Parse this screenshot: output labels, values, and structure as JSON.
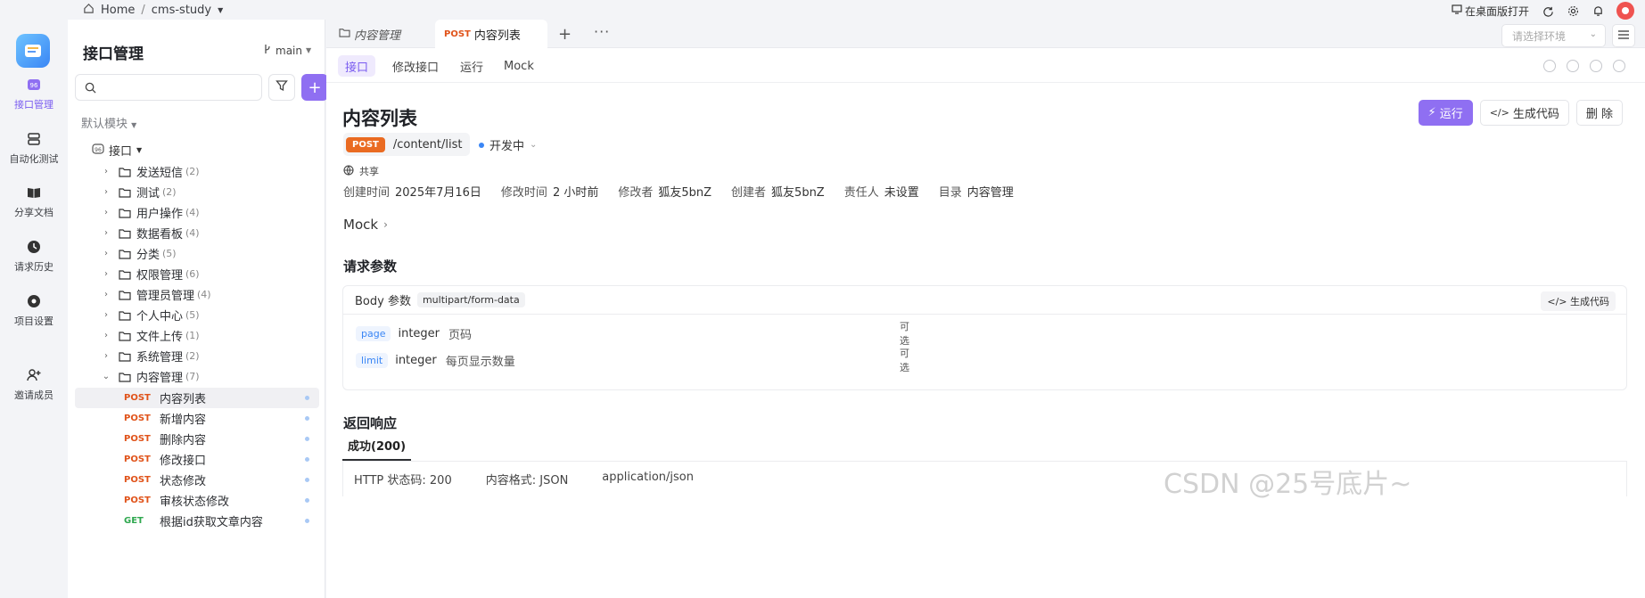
{
  "breadcrumb": {
    "home": "Home",
    "sep": "/",
    "project": "cms-study"
  },
  "topbar": {
    "open_desktop": "在桌面版打开"
  },
  "rail": [
    {
      "label": "接口管理",
      "icon": "api-icon"
    },
    {
      "label": "自动化测试",
      "icon": "automation-icon"
    },
    {
      "label": "分享文档",
      "icon": "book-icon"
    },
    {
      "label": "请求历史",
      "icon": "clock-icon"
    },
    {
      "label": "项目设置",
      "icon": "gear-icon"
    },
    {
      "label": "邀请成员",
      "icon": "user-plus-icon"
    }
  ],
  "sidebar": {
    "title": "接口管理",
    "branch": "main",
    "module": "默认模块",
    "root": "接口",
    "folders": [
      {
        "name": "发送短信",
        "count": "(2)"
      },
      {
        "name": "测试",
        "count": "(2)"
      },
      {
        "name": "用户操作",
        "count": "(4)"
      },
      {
        "name": "数据看板",
        "count": "(4)"
      },
      {
        "name": "分类",
        "count": "(5)"
      },
      {
        "name": "权限管理",
        "count": "(6)"
      },
      {
        "name": "管理员管理",
        "count": "(4)"
      },
      {
        "name": "个人中心",
        "count": "(5)"
      },
      {
        "name": "文件上传",
        "count": "(1)"
      },
      {
        "name": "系统管理",
        "count": "(2)"
      },
      {
        "name": "内容管理",
        "count": "(7)"
      }
    ],
    "apis": [
      {
        "method": "POST",
        "name": "内容列表"
      },
      {
        "method": "POST",
        "name": "新增内容"
      },
      {
        "method": "POST",
        "name": "删除内容"
      },
      {
        "method": "POST",
        "name": "修改接口"
      },
      {
        "method": "POST",
        "name": "状态修改"
      },
      {
        "method": "POST",
        "name": "审核状态修改"
      },
      {
        "method": "GET",
        "name": "根据id获取文章内容"
      }
    ]
  },
  "tabs": {
    "folder_tab": "内容管理",
    "active_method": "POST",
    "active_tab": "内容列表",
    "env_placeholder": "请选择环境"
  },
  "subtabs": [
    "接口",
    "修改接口",
    "运行",
    "Mock"
  ],
  "api": {
    "title": "内容列表",
    "method": "POST",
    "path": "/content/list",
    "status": "开发中",
    "share": "共享",
    "run_label": "运行",
    "gen_code_label": "生成代码",
    "delete_label": "删 除",
    "meta": [
      {
        "k": "创建时间",
        "v": "2025年7月16日"
      },
      {
        "k": "修改时间",
        "v": "2 小时前"
      },
      {
        "k": "修改者",
        "v": "狐友5bnZ"
      },
      {
        "k": "创建者",
        "v": "狐友5bnZ"
      },
      {
        "k": "责任人",
        "v": "未设置"
      },
      {
        "k": "目录",
        "v": "内容管理"
      }
    ],
    "mock": "Mock"
  },
  "request": {
    "title": "请求参数",
    "body_label": "Body 参数",
    "content_type": "multipart/form-data",
    "gen_code": "生成代码",
    "params": [
      {
        "name": "page",
        "type": "integer",
        "desc": "页码",
        "opt": "可选"
      },
      {
        "name": "limit",
        "type": "integer",
        "desc": "每页显示数量",
        "opt": "可选"
      }
    ]
  },
  "response": {
    "title": "返回响应",
    "tab": "成功(200)",
    "status_code": "HTTP 状态码: 200",
    "format": "内容格式: JSON",
    "mime": "application/json"
  },
  "watermark": "CSDN @25号底片~"
}
